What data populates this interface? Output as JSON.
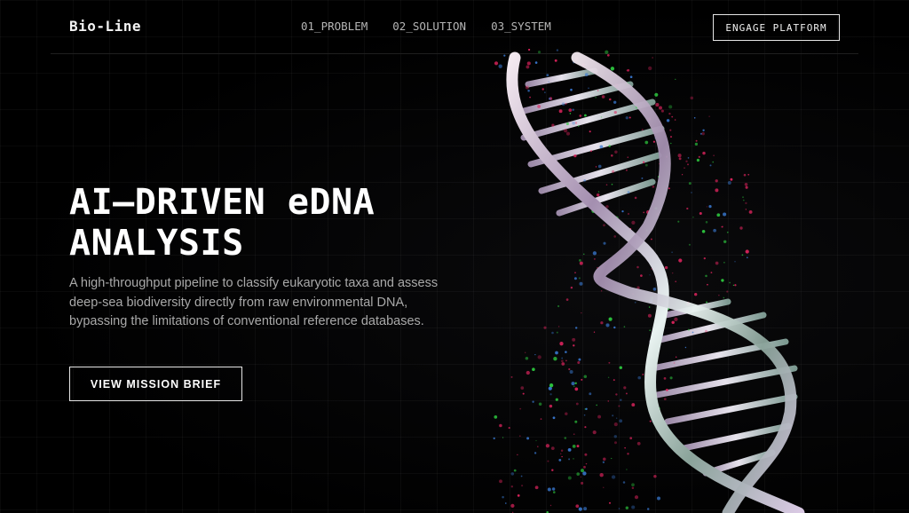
{
  "header": {
    "logo": "Bio-Line",
    "nav": [
      {
        "label": "01_PROBLEM"
      },
      {
        "label": "02_SOLUTION"
      },
      {
        "label": "03_SYSTEM"
      }
    ],
    "cta_label": "ENGAGE PLATFORM"
  },
  "hero": {
    "title_line1": "AI—DRIVEN eDNA",
    "title_line2": "ANALYSIS",
    "description": "A high-throughput pipeline to classify eukaryotic taxa and assess deep-sea biodiversity directly from raw environmental DNA, bypassing the limitations of conventional reference databases.",
    "button_label": "VIEW MISSION BRIEF"
  },
  "illustration": {
    "name": "dna-double-helix-icon",
    "colors": {
      "strand": "#c9c2d6",
      "particle_red": "#e0245e",
      "particle_green": "#2ecc40",
      "particle_blue": "#3a7bd5"
    }
  }
}
